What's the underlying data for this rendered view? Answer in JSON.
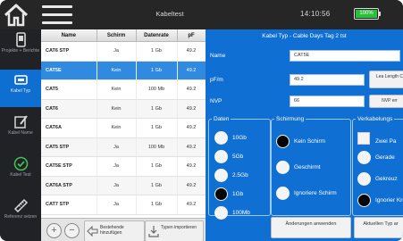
{
  "header": {
    "title": "Kabeltest",
    "time": "14:10:56",
    "battery_label": "100%",
    "battery_level": 1.0,
    "battery_color": "#27c23a"
  },
  "sidebar": {
    "items": [
      {
        "label": "Projekte + Berichte",
        "icon": "phone-icon"
      },
      {
        "label": "Kabel Typ",
        "icon": "cable-icon"
      },
      {
        "label": "Kabel Name",
        "icon": "edit-icon"
      },
      {
        "label": "Kabel Test",
        "icon": "check-circle-icon"
      },
      {
        "label": "Referenz setzen",
        "icon": "ruler-icon"
      }
    ],
    "active_index": 1
  },
  "table": {
    "headers": [
      "Name",
      "Schirm",
      "Datenrate",
      "pF"
    ],
    "rows": [
      {
        "name": "CAT6 STP",
        "schirm": "Ja",
        "datenrate": "1 Gb",
        "pf": "49.2"
      },
      {
        "name": "CAT5E",
        "schirm": "Kein",
        "datenrate": "1 Gb",
        "pf": "49.2"
      },
      {
        "name": "CAT5",
        "schirm": "Kein",
        "datenrate": "100 Mb",
        "pf": "49.2"
      },
      {
        "name": "CAT6",
        "schirm": "Kein",
        "datenrate": "1 Gb",
        "pf": "49.2"
      },
      {
        "name": "CAT6A",
        "schirm": "Kein",
        "datenrate": "1 Gb",
        "pf": "49.2"
      },
      {
        "name": "CAT5 STP",
        "schirm": "Ja",
        "datenrate": "100 Mb",
        "pf": "49.2"
      },
      {
        "name": "CAT5E STP",
        "schirm": "Ja",
        "datenrate": "1 Gb",
        "pf": "49.2"
      },
      {
        "name": "CAT6A STP",
        "schirm": "Ja",
        "datenrate": "1 Gb",
        "pf": "49.2"
      },
      {
        "name": "CAT7 STP",
        "schirm": "Ja",
        "datenrate": "1 Gb",
        "pf": "49.2"
      }
    ],
    "selected_index": 1
  },
  "table_toolbar": {
    "add_label": "+",
    "remove_label": "−",
    "add_existing_label": "Bestehende hinzufügen",
    "import_types_label": "Typen importieren"
  },
  "detail": {
    "title": "Kabel Typ - Cable Days Tag 2 tst",
    "name_label": "Name",
    "name_value": "CAT5E",
    "pfm_label": "pF/m",
    "pfm_value": "49.2",
    "learn_length_label": "Lea Length C",
    "nvp_label": "NVP",
    "nvp_value": "66",
    "nvp_button_label": "NVP err",
    "daten": {
      "legend": "Daten",
      "options": [
        "10Gb",
        "5Gb",
        "2.5Gb",
        "1Gb",
        "100Mb"
      ],
      "selected_index": 3
    },
    "schirmung": {
      "legend": "Schirmung",
      "options": [
        "Kein Schirm",
        "Geschirmt",
        "Ignoriere Schirm"
      ],
      "selected_index": 0
    },
    "verkabelung": {
      "legend": "Verkabelungs",
      "check_label": "Zwei Pa",
      "options": [
        "Gerade",
        "Gekreuz",
        "Ignorier Kreuzu"
      ],
      "selected_index": 2
    },
    "apply_button": "Änderungen anwenden",
    "update_button": "Aktuellen Typ ar"
  }
}
